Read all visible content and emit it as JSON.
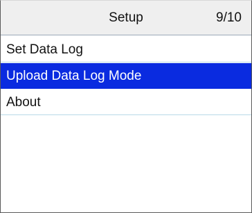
{
  "header": {
    "title": "Setup",
    "page_indicator": "9/10"
  },
  "menu": {
    "items": [
      {
        "label": "Set Data Log",
        "selected": false
      },
      {
        "label": "Upload Data Log Mode",
        "selected": true
      },
      {
        "label": "About",
        "selected": false
      }
    ]
  },
  "colors": {
    "selection": "#0a2be0",
    "header_background": "#efefef",
    "divider": "#b7d9e7"
  }
}
